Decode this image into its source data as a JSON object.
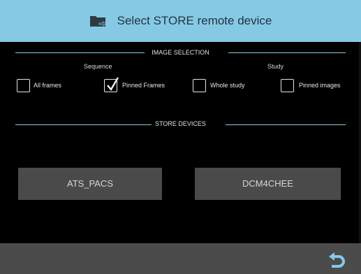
{
  "header": {
    "title": "Select STORE remote device",
    "icon": "folder-export-icon"
  },
  "image_selection": {
    "section_label": "IMAGE SELECTION",
    "sequence_label": "Sequence",
    "study_label": "Study",
    "options": [
      {
        "label": "All frames",
        "checked": false
      },
      {
        "label": "Pinned Frames",
        "checked": true
      },
      {
        "label": "Whole study",
        "checked": false
      },
      {
        "label": "Pinned images",
        "checked": false
      }
    ]
  },
  "store_devices": {
    "section_label": "STORE DEVICES",
    "devices": [
      "ATS_PACS",
      "DCM4CHEE"
    ]
  },
  "footer": {
    "back_icon": "back-arrow-icon"
  },
  "colors": {
    "header_bg": "#86c9e4",
    "button_bg": "#4a4a4a",
    "footer_bg": "#4b4b4b",
    "divider": "#8ec9df"
  }
}
